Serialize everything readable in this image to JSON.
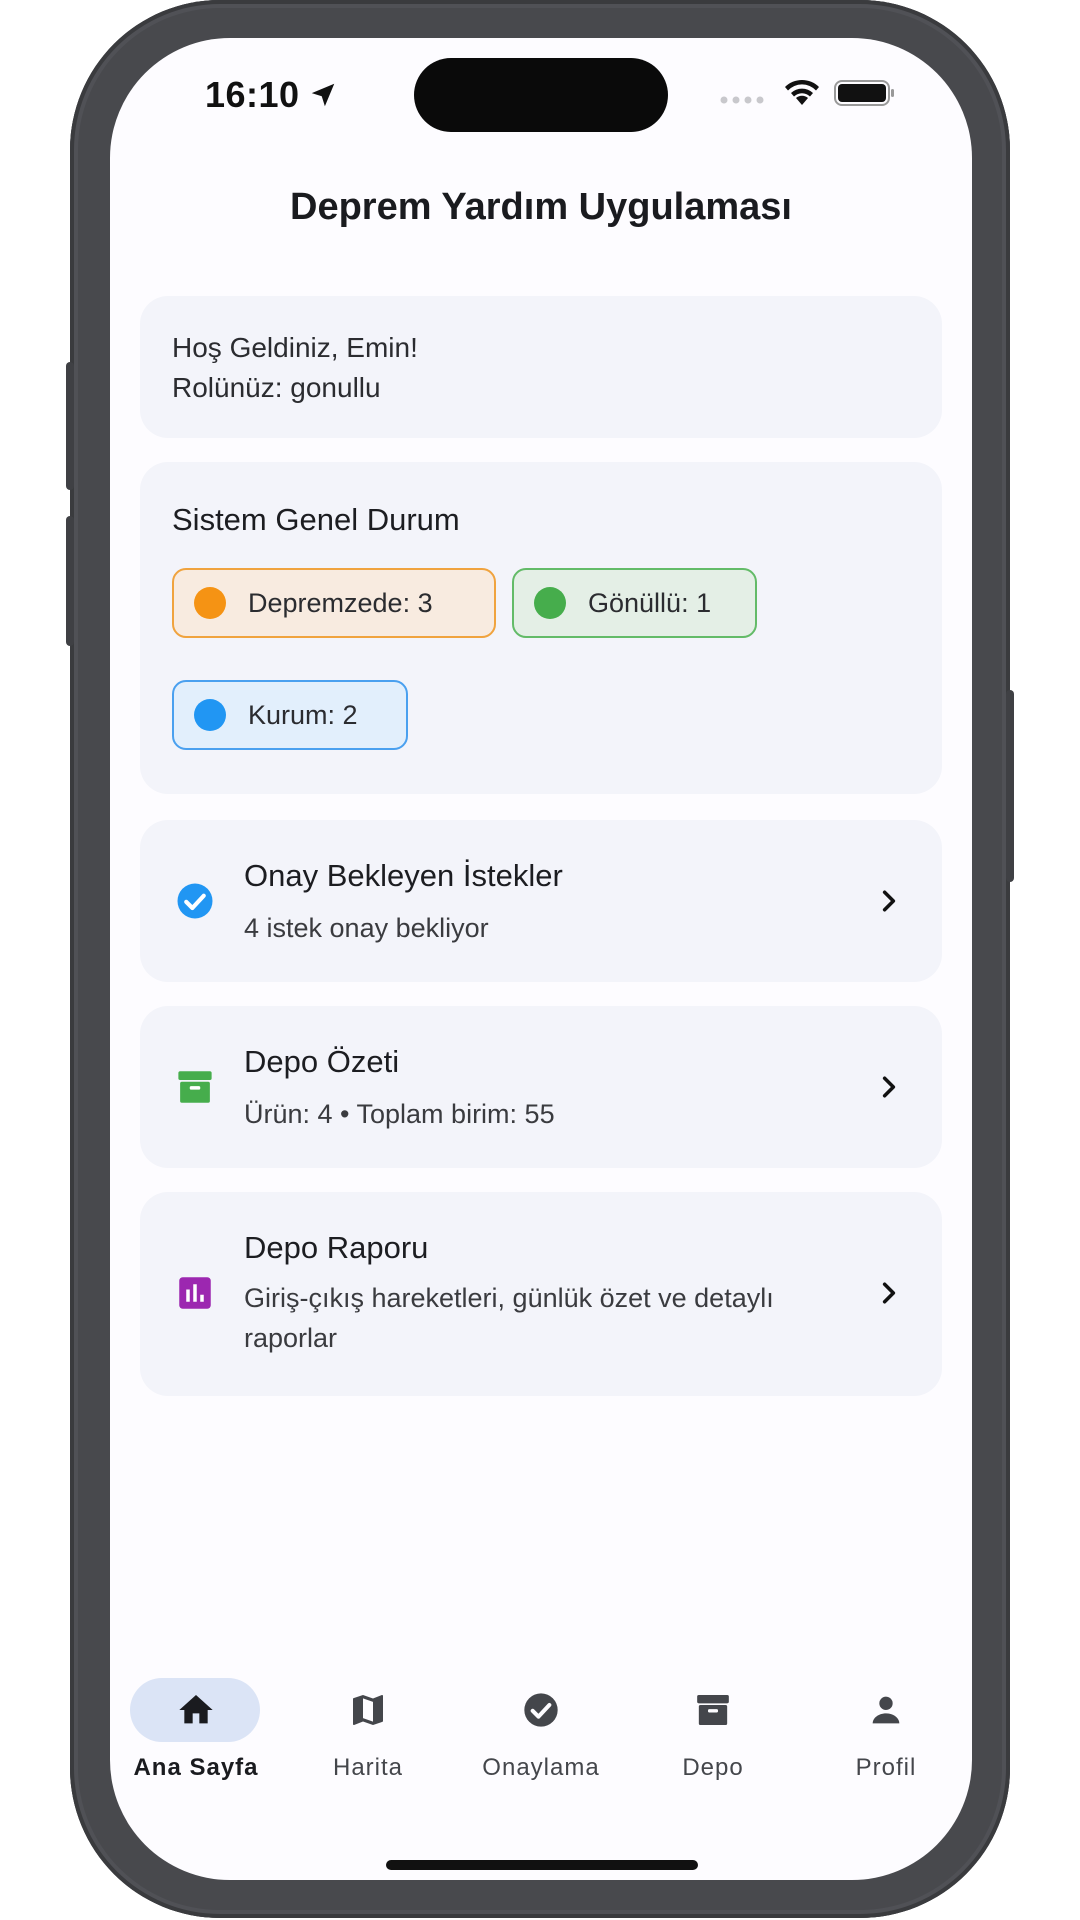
{
  "status_bar": {
    "time": "16:10",
    "icons": [
      "location-arrow-icon",
      "signal-dots-icon",
      "wifi-icon",
      "battery-icon"
    ]
  },
  "header": {
    "title": "Deprem Yardım Uygulaması"
  },
  "welcome": {
    "greeting": "Hoş Geldiniz, Emin!",
    "role": "Rolünüz: gonullu"
  },
  "system_status": {
    "title": "Sistem Genel Durum",
    "chips": [
      {
        "label": "Depremzede: 3",
        "color": "#f59314"
      },
      {
        "label": "Gönüllü: 1",
        "color": "#46ad4c"
      },
      {
        "label": "Kurum: 2",
        "color": "#2196f3"
      }
    ]
  },
  "cards": [
    {
      "title": "Onay Bekleyen İstekler",
      "subtitle": "4 istek onay bekliyor",
      "icon": "check-circle-icon",
      "icon_color": "#2196f3"
    },
    {
      "title": "Depo Özeti",
      "subtitle": "Ürün: 4 • Toplam birim: 55",
      "icon": "archive-icon",
      "icon_color": "#46ad4c"
    },
    {
      "title": "Depo Raporu",
      "subtitle": "Giriş-çıkış hareketleri, günlük özet ve detaylı raporlar",
      "icon": "bar-chart-icon",
      "icon_color": "#9c27b0"
    }
  ],
  "bottom_nav": {
    "active": "Ana Sayfa",
    "items": [
      {
        "label": "Ana Sayfa",
        "icon": "home-icon"
      },
      {
        "label": "Harita",
        "icon": "map-icon"
      },
      {
        "label": "Onaylama",
        "icon": "check-circle-icon"
      },
      {
        "label": "Depo",
        "icon": "archive-icon"
      },
      {
        "label": "Profil",
        "icon": "person-icon"
      }
    ]
  }
}
